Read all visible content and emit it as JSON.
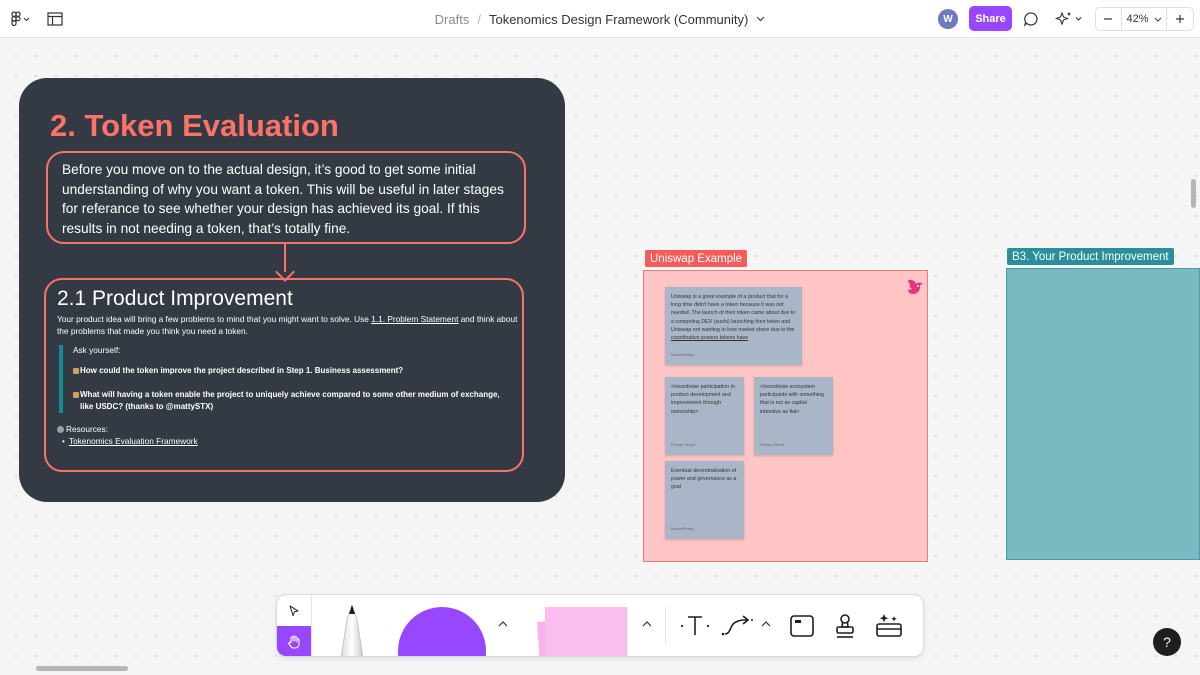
{
  "header": {
    "breadcrumb_root": "Drafts",
    "breadcrumb_sep": "/",
    "file_name": "Tokenomics Design Framework (Community)",
    "avatar_initial": "W",
    "share_label": "Share",
    "zoom": "42%"
  },
  "section": {
    "title": "2. Token Evaluation",
    "intro": "Before you move on to the actual design, it’s good to get some initial understanding of why you want a token. This will be useful in later stages for referance to see whether your design has achieved its goal. If this results in not needing a token, that’s totally fine.",
    "sub_title": "2.1 Product Improvement",
    "body_pre": "Your product idea will bring a few problems to mind that you might want to solve. Use ",
    "body_link": "1.1. Problem Statement",
    "body_post": " and think about the problems that made you think you need a token.",
    "ask": "Ask yourself:",
    "q1": "How could the token improve the project described in Step 1. Business assessment?",
    "q2": "What will having a token enable the project to uniquely achieve compared to some other medium of exchange, like USDC? (thanks to @mattySTX)",
    "resources_label": "Resources:",
    "resource_link": "Tokenomics Evaluation Framework"
  },
  "uniswap": {
    "tag": "Uniswap Example",
    "note_main_pre": "Uniswap is a great example of a product that for a long time didn't have a token because it was not needed. The launch of their token came about due to a competing DEX (sushi) launching their token and Uniswap not wanting to lose market share due to the ",
    "note_main_link": "coordinative powers tokens have",
    "note_main_author": "MasonPosey",
    "notes": [
      {
        "text": "<Incentivise participation in product development and improvement through ownership>",
        "author": "Florian Strauf"
      },
      {
        "text": "<Incentivise ecosystem participants with something that is not as capital intensive as fiat>",
        "author": "Florian Strauf"
      },
      {
        "text": "Eventual decentralisation of power and governance as a goal",
        "author": "MasonPosey"
      }
    ]
  },
  "b3": {
    "tag": "B3. Your Product Improvement"
  },
  "help_label": "?",
  "colors": {
    "accent": "#9747ff",
    "section_bg": "#333a43",
    "coral": "#fb7268",
    "teal": "#2a8f9c",
    "uniswap_bg": "#ffc4c4",
    "sticky": "#a9b6c8"
  }
}
